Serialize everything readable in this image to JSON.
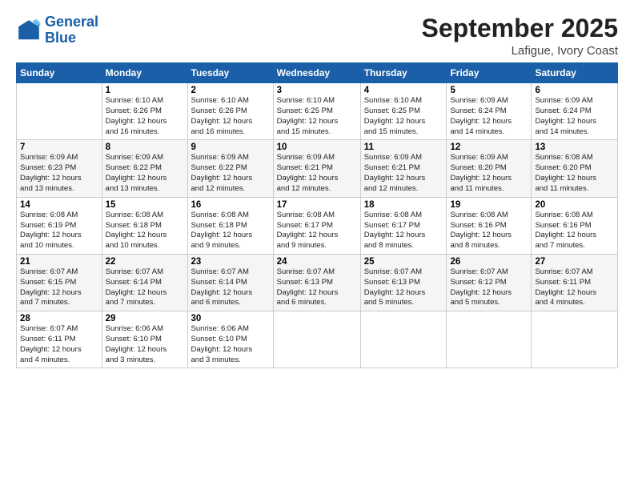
{
  "logo": {
    "line1": "General",
    "line2": "Blue"
  },
  "title": "September 2025",
  "subtitle": "Lafigue, Ivory Coast",
  "days_header": [
    "Sunday",
    "Monday",
    "Tuesday",
    "Wednesday",
    "Thursday",
    "Friday",
    "Saturday"
  ],
  "weeks": [
    [
      {
        "num": "",
        "detail": ""
      },
      {
        "num": "1",
        "detail": "Sunrise: 6:10 AM\nSunset: 6:26 PM\nDaylight: 12 hours\nand 16 minutes."
      },
      {
        "num": "2",
        "detail": "Sunrise: 6:10 AM\nSunset: 6:26 PM\nDaylight: 12 hours\nand 16 minutes."
      },
      {
        "num": "3",
        "detail": "Sunrise: 6:10 AM\nSunset: 6:25 PM\nDaylight: 12 hours\nand 15 minutes."
      },
      {
        "num": "4",
        "detail": "Sunrise: 6:10 AM\nSunset: 6:25 PM\nDaylight: 12 hours\nand 15 minutes."
      },
      {
        "num": "5",
        "detail": "Sunrise: 6:09 AM\nSunset: 6:24 PM\nDaylight: 12 hours\nand 14 minutes."
      },
      {
        "num": "6",
        "detail": "Sunrise: 6:09 AM\nSunset: 6:24 PM\nDaylight: 12 hours\nand 14 minutes."
      }
    ],
    [
      {
        "num": "7",
        "detail": "Sunrise: 6:09 AM\nSunset: 6:23 PM\nDaylight: 12 hours\nand 13 minutes."
      },
      {
        "num": "8",
        "detail": "Sunrise: 6:09 AM\nSunset: 6:22 PM\nDaylight: 12 hours\nand 13 minutes."
      },
      {
        "num": "9",
        "detail": "Sunrise: 6:09 AM\nSunset: 6:22 PM\nDaylight: 12 hours\nand 12 minutes."
      },
      {
        "num": "10",
        "detail": "Sunrise: 6:09 AM\nSunset: 6:21 PM\nDaylight: 12 hours\nand 12 minutes."
      },
      {
        "num": "11",
        "detail": "Sunrise: 6:09 AM\nSunset: 6:21 PM\nDaylight: 12 hours\nand 12 minutes."
      },
      {
        "num": "12",
        "detail": "Sunrise: 6:09 AM\nSunset: 6:20 PM\nDaylight: 12 hours\nand 11 minutes."
      },
      {
        "num": "13",
        "detail": "Sunrise: 6:08 AM\nSunset: 6:20 PM\nDaylight: 12 hours\nand 11 minutes."
      }
    ],
    [
      {
        "num": "14",
        "detail": "Sunrise: 6:08 AM\nSunset: 6:19 PM\nDaylight: 12 hours\nand 10 minutes."
      },
      {
        "num": "15",
        "detail": "Sunrise: 6:08 AM\nSunset: 6:18 PM\nDaylight: 12 hours\nand 10 minutes."
      },
      {
        "num": "16",
        "detail": "Sunrise: 6:08 AM\nSunset: 6:18 PM\nDaylight: 12 hours\nand 9 minutes."
      },
      {
        "num": "17",
        "detail": "Sunrise: 6:08 AM\nSunset: 6:17 PM\nDaylight: 12 hours\nand 9 minutes."
      },
      {
        "num": "18",
        "detail": "Sunrise: 6:08 AM\nSunset: 6:17 PM\nDaylight: 12 hours\nand 8 minutes."
      },
      {
        "num": "19",
        "detail": "Sunrise: 6:08 AM\nSunset: 6:16 PM\nDaylight: 12 hours\nand 8 minutes."
      },
      {
        "num": "20",
        "detail": "Sunrise: 6:08 AM\nSunset: 6:16 PM\nDaylight: 12 hours\nand 7 minutes."
      }
    ],
    [
      {
        "num": "21",
        "detail": "Sunrise: 6:07 AM\nSunset: 6:15 PM\nDaylight: 12 hours\nand 7 minutes."
      },
      {
        "num": "22",
        "detail": "Sunrise: 6:07 AM\nSunset: 6:14 PM\nDaylight: 12 hours\nand 7 minutes."
      },
      {
        "num": "23",
        "detail": "Sunrise: 6:07 AM\nSunset: 6:14 PM\nDaylight: 12 hours\nand 6 minutes."
      },
      {
        "num": "24",
        "detail": "Sunrise: 6:07 AM\nSunset: 6:13 PM\nDaylight: 12 hours\nand 6 minutes."
      },
      {
        "num": "25",
        "detail": "Sunrise: 6:07 AM\nSunset: 6:13 PM\nDaylight: 12 hours\nand 5 minutes."
      },
      {
        "num": "26",
        "detail": "Sunrise: 6:07 AM\nSunset: 6:12 PM\nDaylight: 12 hours\nand 5 minutes."
      },
      {
        "num": "27",
        "detail": "Sunrise: 6:07 AM\nSunset: 6:11 PM\nDaylight: 12 hours\nand 4 minutes."
      }
    ],
    [
      {
        "num": "28",
        "detail": "Sunrise: 6:07 AM\nSunset: 6:11 PM\nDaylight: 12 hours\nand 4 minutes."
      },
      {
        "num": "29",
        "detail": "Sunrise: 6:06 AM\nSunset: 6:10 PM\nDaylight: 12 hours\nand 3 minutes."
      },
      {
        "num": "30",
        "detail": "Sunrise: 6:06 AM\nSunset: 6:10 PM\nDaylight: 12 hours\nand 3 minutes."
      },
      {
        "num": "",
        "detail": ""
      },
      {
        "num": "",
        "detail": ""
      },
      {
        "num": "",
        "detail": ""
      },
      {
        "num": "",
        "detail": ""
      }
    ]
  ]
}
